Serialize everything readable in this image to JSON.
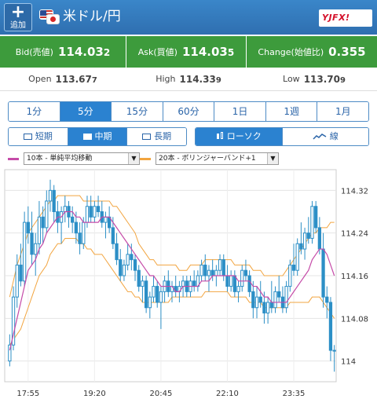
{
  "header": {
    "add_label": "追加",
    "title": "米ドル/円",
    "logo_main": "YJFX!",
    "logo_icon": "yjfx-logo",
    "flags": [
      "us-flag-icon",
      "jp-flag-icon"
    ]
  },
  "quote": {
    "bid_label": "Bid(売値)",
    "bid_main": "114.03",
    "bid_last": "2",
    "ask_label": "Ask(買値)",
    "ask_main": "114.03",
    "ask_last": "5",
    "change_label": "Change(始値比)",
    "change_value": "0.355",
    "open_label": "Open",
    "open_main": "113.67",
    "open_last": "7",
    "high_label": "High",
    "high_main": "114.33",
    "high_last": "9",
    "low_label": "Low",
    "low_main": "113.70",
    "low_last": "9"
  },
  "timeframes": [
    "1分",
    "5分",
    "15分",
    "60分",
    "1日",
    "1週",
    "1月"
  ],
  "timeframe_selected": "5分",
  "terms": [
    "短期",
    "中期",
    "長期"
  ],
  "term_selected": "中期",
  "chart_types": [
    "ローソク",
    "線"
  ],
  "chart_type_selected": "ローソク",
  "indicators": {
    "ma_label": "10本 - 単純平均移動",
    "ma_color": "#c54ba8",
    "bb_label": "20本 - ボリンジャーバンド+1",
    "bb_color": "#f2a540"
  },
  "colors": {
    "header_blue": "#2f6fb0",
    "quote_green": "#3d9b3c",
    "tab_active": "#2b82d0",
    "candle": "#2c8fc6"
  },
  "chart_data": {
    "type": "candlestick",
    "x_labels": [
      "17:55",
      "19:20",
      "20:45",
      "22:10",
      "23:35"
    ],
    "y_ticks": [
      114,
      114.08,
      114.16,
      114.24,
      114.32
    ],
    "ylim": [
      113.97,
      114.35
    ],
    "candles": [
      [
        114.0,
        114.05,
        113.99,
        114.03
      ],
      [
        114.03,
        114.14,
        114.02,
        114.12
      ],
      [
        114.12,
        114.2,
        114.1,
        114.18
      ],
      [
        114.18,
        114.22,
        114.14,
        114.15
      ],
      [
        114.15,
        114.28,
        114.14,
        114.26
      ],
      [
        114.26,
        114.29,
        114.22,
        114.24
      ],
      [
        114.24,
        114.28,
        114.18,
        114.2
      ],
      [
        114.2,
        114.24,
        114.16,
        114.22
      ],
      [
        114.22,
        114.3,
        114.2,
        114.27
      ],
      [
        114.27,
        114.29,
        114.22,
        114.25
      ],
      [
        114.25,
        114.32,
        114.24,
        114.3
      ],
      [
        114.3,
        114.34,
        114.28,
        114.32
      ],
      [
        114.32,
        114.33,
        114.26,
        114.28
      ],
      [
        114.28,
        114.3,
        114.24,
        114.26
      ],
      [
        114.26,
        114.29,
        114.22,
        114.28
      ],
      [
        114.28,
        114.31,
        114.26,
        114.29
      ],
      [
        114.29,
        114.3,
        114.25,
        114.27
      ],
      [
        114.27,
        114.29,
        114.24,
        114.26
      ],
      [
        114.26,
        114.28,
        114.22,
        114.24
      ],
      [
        114.24,
        114.26,
        114.2,
        114.22
      ],
      [
        114.22,
        114.27,
        114.21,
        114.26
      ],
      [
        114.26,
        114.31,
        114.25,
        114.29
      ],
      [
        114.29,
        114.31,
        114.26,
        114.27
      ],
      [
        114.27,
        114.3,
        114.26,
        114.29
      ],
      [
        114.29,
        114.31,
        114.27,
        114.28
      ],
      [
        114.28,
        114.3,
        114.25,
        114.26
      ],
      [
        114.26,
        114.28,
        114.23,
        114.27
      ],
      [
        114.27,
        114.29,
        114.24,
        114.25
      ],
      [
        114.25,
        114.27,
        114.21,
        114.22
      ],
      [
        114.22,
        114.24,
        114.18,
        114.19
      ],
      [
        114.19,
        114.21,
        114.15,
        114.16
      ],
      [
        114.16,
        114.19,
        114.15,
        114.18
      ],
      [
        114.18,
        114.22,
        114.17,
        114.2
      ],
      [
        114.2,
        114.22,
        114.17,
        114.19
      ],
      [
        114.19,
        114.2,
        114.15,
        114.17
      ],
      [
        114.17,
        114.18,
        114.13,
        114.14
      ],
      [
        114.14,
        114.16,
        114.11,
        114.15
      ],
      [
        114.15,
        114.16,
        114.09,
        114.1
      ],
      [
        114.1,
        114.13,
        114.08,
        114.12
      ],
      [
        114.12,
        114.16,
        114.11,
        114.14
      ],
      [
        114.14,
        114.15,
        114.1,
        114.11
      ],
      [
        114.11,
        114.14,
        114.06,
        114.13
      ],
      [
        114.13,
        114.16,
        114.11,
        114.15
      ],
      [
        114.15,
        114.17,
        114.12,
        114.13
      ],
      [
        114.13,
        114.15,
        114.11,
        114.14
      ],
      [
        114.14,
        114.16,
        114.12,
        114.13
      ],
      [
        114.13,
        114.15,
        114.11,
        114.14
      ],
      [
        114.14,
        114.16,
        114.12,
        114.15
      ],
      [
        114.15,
        114.16,
        114.12,
        114.13
      ],
      [
        114.13,
        114.16,
        114.12,
        114.15
      ],
      [
        114.15,
        114.17,
        114.13,
        114.14
      ],
      [
        114.14,
        114.17,
        114.13,
        114.16
      ],
      [
        114.16,
        114.19,
        114.15,
        114.18
      ],
      [
        114.18,
        114.2,
        114.15,
        114.16
      ],
      [
        114.16,
        114.18,
        114.13,
        114.17
      ],
      [
        114.17,
        114.19,
        114.15,
        114.16
      ],
      [
        114.16,
        114.18,
        114.14,
        114.17
      ],
      [
        114.17,
        114.2,
        114.16,
        114.19
      ],
      [
        114.19,
        114.2,
        114.15,
        114.16
      ],
      [
        114.16,
        114.18,
        114.13,
        114.14
      ],
      [
        114.14,
        114.17,
        114.13,
        114.16
      ],
      [
        114.16,
        114.17,
        114.12,
        114.13
      ],
      [
        114.13,
        114.15,
        114.11,
        114.14
      ],
      [
        114.14,
        114.18,
        114.13,
        114.17
      ],
      [
        114.17,
        114.19,
        114.15,
        114.16
      ],
      [
        114.16,
        114.17,
        114.12,
        114.13
      ],
      [
        114.13,
        114.15,
        114.08,
        114.1
      ],
      [
        114.1,
        114.14,
        114.08,
        114.12
      ],
      [
        114.12,
        114.15,
        114.1,
        114.11
      ],
      [
        114.11,
        114.13,
        114.07,
        114.09
      ],
      [
        114.09,
        114.12,
        114.07,
        114.11
      ],
      [
        114.11,
        114.15,
        114.09,
        114.1
      ],
      [
        114.1,
        114.14,
        114.09,
        114.13
      ],
      [
        114.13,
        114.16,
        114.11,
        114.12
      ],
      [
        114.12,
        114.14,
        114.09,
        114.1
      ],
      [
        114.1,
        114.15,
        114.09,
        114.14
      ],
      [
        114.14,
        114.19,
        114.13,
        114.18
      ],
      [
        114.18,
        114.22,
        114.16,
        114.17
      ],
      [
        114.17,
        114.23,
        114.16,
        114.22
      ],
      [
        114.22,
        114.26,
        114.2,
        114.21
      ],
      [
        114.21,
        114.25,
        114.19,
        114.24
      ],
      [
        114.24,
        114.27,
        114.22,
        114.23
      ],
      [
        114.23,
        114.3,
        114.22,
        114.29
      ],
      [
        114.29,
        114.3,
        114.24,
        114.25
      ],
      [
        114.25,
        114.27,
        114.2,
        114.21
      ],
      [
        114.21,
        114.24,
        114.1,
        114.12
      ],
      [
        114.12,
        114.14,
        114.08,
        114.11
      ],
      [
        114.11,
        114.12,
        114.0,
        114.02
      ],
      [
        114.02,
        114.03,
        113.98,
        114.02
      ]
    ],
    "ma": [
      114.02,
      114.05,
      114.08,
      114.11,
      114.14,
      114.17,
      114.18,
      114.19,
      114.21,
      114.22,
      114.24,
      114.25,
      114.26,
      114.27,
      114.27,
      114.28,
      114.28,
      114.28,
      114.27,
      114.27,
      114.26,
      114.26,
      114.26,
      114.26,
      114.26,
      114.27,
      114.27,
      114.27,
      114.26,
      114.25,
      114.24,
      114.23,
      114.22,
      114.21,
      114.2,
      114.19,
      114.18,
      114.17,
      114.16,
      114.16,
      114.15,
      114.14,
      114.14,
      114.14,
      114.14,
      114.13,
      114.13,
      114.14,
      114.14,
      114.14,
      114.14,
      114.14,
      114.15,
      114.15,
      114.15,
      114.16,
      114.16,
      114.16,
      114.16,
      114.16,
      114.16,
      114.16,
      114.15,
      114.15,
      114.15,
      114.15,
      114.14,
      114.14,
      114.13,
      114.12,
      114.12,
      114.11,
      114.11,
      114.11,
      114.11,
      114.11,
      114.12,
      114.13,
      114.14,
      114.15,
      114.16,
      114.17,
      114.19,
      114.2,
      114.21,
      114.21,
      114.2,
      114.18,
      114.16
    ],
    "bb_upper": [
      114.12,
      114.15,
      114.18,
      114.2,
      114.22,
      114.24,
      114.25,
      114.26,
      114.27,
      114.28,
      114.29,
      114.3,
      114.3,
      114.31,
      114.31,
      114.31,
      114.31,
      114.31,
      114.31,
      114.31,
      114.3,
      114.3,
      114.3,
      114.3,
      114.3,
      114.3,
      114.3,
      114.3,
      114.29,
      114.29,
      114.28,
      114.27,
      114.26,
      114.25,
      114.24,
      114.22,
      114.21,
      114.2,
      114.19,
      114.19,
      114.18,
      114.18,
      114.18,
      114.18,
      114.18,
      114.18,
      114.17,
      114.17,
      114.17,
      114.18,
      114.18,
      114.18,
      114.18,
      114.19,
      114.19,
      114.19,
      114.19,
      114.19,
      114.19,
      114.19,
      114.19,
      114.18,
      114.18,
      114.18,
      114.18,
      114.18,
      114.17,
      114.17,
      114.17,
      114.16,
      114.16,
      114.16,
      114.16,
      114.16,
      114.16,
      114.17,
      114.18,
      114.19,
      114.2,
      114.21,
      114.22,
      114.23,
      114.24,
      114.24,
      114.25,
      114.25,
      114.25,
      114.26,
      114.26
    ],
    "bb_lower": [
      114.03,
      114.04,
      114.05,
      114.06,
      114.08,
      114.1,
      114.12,
      114.14,
      114.16,
      114.17,
      114.18,
      114.2,
      114.21,
      114.22,
      114.22,
      114.23,
      114.23,
      114.23,
      114.23,
      114.22,
      114.22,
      114.21,
      114.21,
      114.2,
      114.2,
      114.2,
      114.19,
      114.18,
      114.17,
      114.16,
      114.15,
      114.14,
      114.13,
      114.13,
      114.12,
      114.12,
      114.11,
      114.11,
      114.11,
      114.11,
      114.11,
      114.11,
      114.11,
      114.11,
      114.12,
      114.12,
      114.12,
      114.12,
      114.12,
      114.12,
      114.12,
      114.12,
      114.12,
      114.13,
      114.13,
      114.13,
      114.13,
      114.13,
      114.13,
      114.13,
      114.12,
      114.12,
      114.12,
      114.12,
      114.12,
      114.11,
      114.11,
      114.11,
      114.11,
      114.1,
      114.1,
      114.1,
      114.1,
      114.1,
      114.1,
      114.1,
      114.11,
      114.11,
      114.11,
      114.11,
      114.11,
      114.11,
      114.12,
      114.12,
      114.12,
      114.11,
      114.1,
      114.09,
      114.08
    ]
  }
}
